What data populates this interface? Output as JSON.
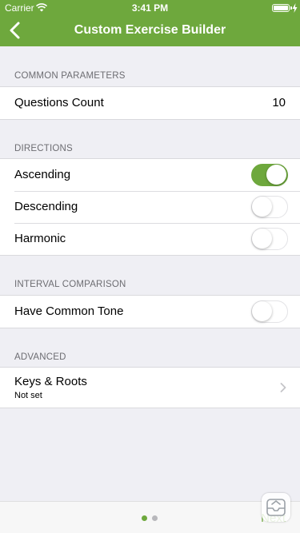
{
  "status_bar": {
    "carrier": "Carrier",
    "time": "3:41 PM",
    "battery_level": 1.0
  },
  "nav": {
    "title": "Custom Exercise Builder",
    "back_icon": "chevron-left-icon"
  },
  "sections": {
    "common": {
      "header": "COMMON PARAMETERS",
      "questions_label": "Questions Count",
      "questions_value": "10"
    },
    "directions": {
      "header": "DIRECTIONS",
      "ascending_label": "Ascending",
      "ascending_on": true,
      "descending_label": "Descending",
      "descending_on": false,
      "harmonic_label": "Harmonic",
      "harmonic_on": false
    },
    "interval_comparison": {
      "header": "INTERVAL COMPARISON",
      "common_tone_label": "Have Common Tone",
      "common_tone_on": false
    },
    "advanced": {
      "header": "ADVANCED",
      "keys_roots_title": "Keys & Roots",
      "keys_roots_subtitle": "Not set"
    }
  },
  "footer": {
    "current_page": 1,
    "page_count": 2,
    "next_label": "Next"
  },
  "colors": {
    "accent": "#6ea83d",
    "background": "#efeff4",
    "section_header": "#6d6d72"
  }
}
